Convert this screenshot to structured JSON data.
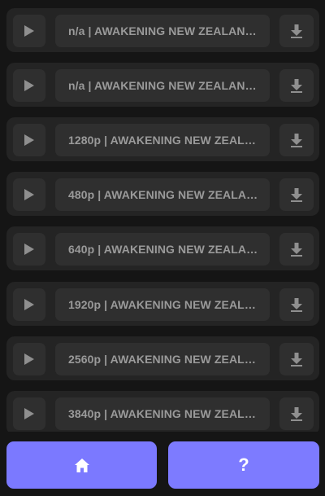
{
  "items": [
    {
      "title": "n/a | AWAKENING NEW ZEALAND ...",
      "play_icon": "play-icon",
      "download_icon": "download-icon"
    },
    {
      "title": "n/a | AWAKENING NEW ZEALAND ...",
      "play_icon": "play-icon",
      "download_icon": "download-icon"
    },
    {
      "title": "1280p | AWAKENING NEW ZEALA...",
      "play_icon": "play-icon",
      "download_icon": "download-icon"
    },
    {
      "title": "480p | AWAKENING NEW ZEALAN...",
      "play_icon": "play-icon",
      "download_icon": "download-icon"
    },
    {
      "title": "640p | AWAKENING NEW ZEALAN...",
      "play_icon": "play-icon",
      "download_icon": "download-icon"
    },
    {
      "title": "1920p | AWAKENING NEW ZEALA...",
      "play_icon": "play-icon",
      "download_icon": "download-icon"
    },
    {
      "title": "2560p | AWAKENING NEW ZEALA...",
      "play_icon": "play-icon",
      "download_icon": "download-icon"
    },
    {
      "title": "3840p | AWAKENING NEW ZEALA...",
      "play_icon": "play-icon",
      "download_icon": "download-icon"
    }
  ],
  "nav": {
    "home_icon": "home-icon",
    "help_label": "?",
    "help_icon": "question-mark-icon"
  },
  "colors": {
    "background": "#151515",
    "row": "#242424",
    "control": "#2f2f2f",
    "text": "#9a9a9a",
    "icon": "#8f8f8f",
    "accent": "#7b79ff"
  }
}
